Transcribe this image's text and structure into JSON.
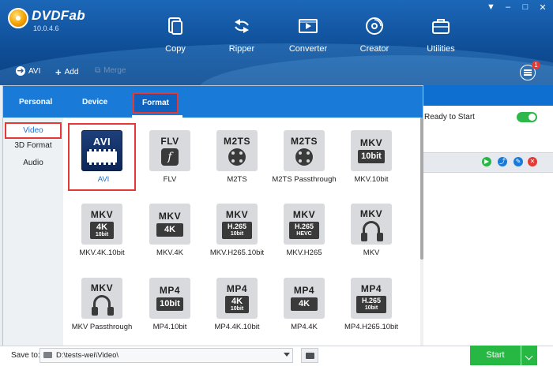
{
  "app": {
    "name": "DVDFab",
    "version": "10.0.4.6"
  },
  "window_controls": [
    "▼",
    "–",
    "□",
    "✕"
  ],
  "modules": [
    {
      "label": "Copy",
      "icon": "copy-icon"
    },
    {
      "label": "Ripper",
      "icon": "ripper-icon"
    },
    {
      "label": "Converter",
      "icon": "converter-icon"
    },
    {
      "label": "Creator",
      "icon": "creator-icon"
    },
    {
      "label": "Utilities",
      "icon": "utilities-icon"
    }
  ],
  "toolbar": {
    "profile_label": "AVI",
    "add_label": "Add",
    "merge_label": "Merge",
    "notification_count": "1"
  },
  "popup": {
    "tabs": [
      "Personal",
      "Device",
      "Format"
    ],
    "selected_tab": "Format",
    "categories": [
      "Video",
      "3D Format",
      "Audio"
    ],
    "selected_category": "Video",
    "formats": [
      {
        "label": "AVI",
        "title": "AVI",
        "sub": "",
        "glyph": "film",
        "selected": true
      },
      {
        "label": "FLV",
        "title": "FLV",
        "sub": "",
        "glyph": "flash"
      },
      {
        "label": "M2TS",
        "title": "M2TS",
        "sub": "",
        "glyph": "reel"
      },
      {
        "label": "M2TS Passthrough",
        "title": "M2TS",
        "sub": "",
        "glyph": "reel"
      },
      {
        "label": "MKV.10bit",
        "title": "MKV",
        "sub": "10bit",
        "glyph": "box1"
      },
      {
        "label": "MKV.4K.10bit",
        "title": "MKV",
        "sub": "4K",
        "sub2": "10bit",
        "glyph": "box2"
      },
      {
        "label": "MKV.4K",
        "title": "MKV",
        "sub": "4K",
        "glyph": "box1"
      },
      {
        "label": "MKV.H265.10bit",
        "title": "MKV",
        "sub": "H.265",
        "sub2": "10bit",
        "glyph": "box3"
      },
      {
        "label": "MKV.H265",
        "title": "MKV",
        "sub": "H.265",
        "sub2": "HEVC",
        "glyph": "box3"
      },
      {
        "label": "MKV",
        "title": "MKV",
        "sub": "",
        "glyph": "pass"
      },
      {
        "label": "MKV Passthrough",
        "title": "MKV",
        "sub": "",
        "glyph": "pass"
      },
      {
        "label": "MP4.10bit",
        "title": "MP4",
        "sub": "10bit",
        "glyph": "box1"
      },
      {
        "label": "MP4.4K.10bit",
        "title": "MP4",
        "sub": "4K",
        "sub2": "10bit",
        "glyph": "box2"
      },
      {
        "label": "MP4.4K",
        "title": "MP4",
        "sub": "4K",
        "glyph": "box1"
      },
      {
        "label": "MP4.H265.10bit",
        "title": "MP4",
        "sub": "H.265",
        "sub2": "10bit",
        "glyph": "box3"
      }
    ]
  },
  "task": {
    "status": "Ready to Start",
    "enabled": true
  },
  "task_actions": [
    "play-icon",
    "share-icon",
    "edit-icon",
    "remove-icon"
  ],
  "bottom": {
    "save_to_label": "Save to:",
    "save_path": "D:\\tests-wei\\Video\\",
    "start_label": "Start"
  },
  "colors": {
    "header": "#0f4f98",
    "popup_tab_bar": "#1a7ad8",
    "selection": "#e53935",
    "start": "#27b844"
  }
}
